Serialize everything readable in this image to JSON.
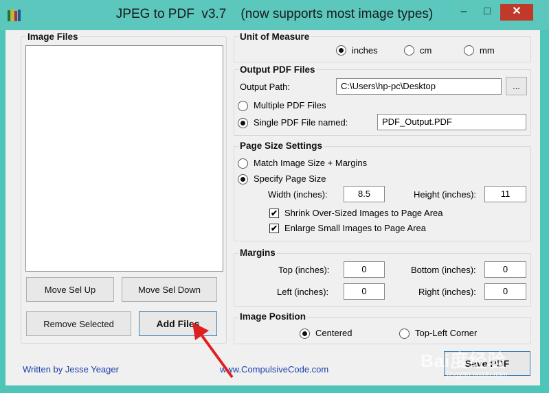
{
  "window": {
    "title": "JPEG to PDF  v3.7    (now supports most image types)",
    "minimize": "–",
    "maximize": "□",
    "close": "✕"
  },
  "image_files": {
    "title": "Image Files",
    "items": [],
    "move_up": "Move Sel Up",
    "move_down": "Move Sel Down",
    "remove": "Remove Selected",
    "add": "Add Files"
  },
  "unit": {
    "title": "Unit of Measure",
    "options": [
      "inches",
      "cm",
      "mm"
    ],
    "selected": "inches"
  },
  "output": {
    "title": "Output PDF Files",
    "path_label": "Output Path:",
    "path_value": "C:\\Users\\hp-pc\\Desktop",
    "browse": "...",
    "multiple_label": "Multiple PDF Files",
    "single_label": "Single PDF File named:",
    "single_value": "PDF_Output.PDF",
    "selected": "single"
  },
  "page_size": {
    "title": "Page Size Settings",
    "match_label": "Match Image Size + Margins",
    "specify_label": "Specify Page Size",
    "selected": "specify",
    "width_label": "Width (inches):",
    "width_value": "8.5",
    "height_label": "Height (inches):",
    "height_value": "11",
    "shrink_label": "Shrink Over-Sized Images to Page Area",
    "shrink_checked": true,
    "enlarge_label": "Enlarge Small Images to Page Area",
    "enlarge_checked": true,
    "check_mark": "✔"
  },
  "margins": {
    "title": "Margins",
    "top_label": "Top (inches):",
    "top_value": "0",
    "bottom_label": "Bottom (inches):",
    "bottom_value": "0",
    "left_label": "Left (inches):",
    "left_value": "0",
    "right_label": "Right (inches):",
    "right_value": "0"
  },
  "image_position": {
    "title": "Image Position",
    "centered_label": "Centered",
    "topleft_label": "Top-Left Corner",
    "selected": "centered"
  },
  "footer": {
    "author": "Written by Jesse Yeager",
    "website": "www.CompulsiveCode.com",
    "save": "Save PDF"
  },
  "overlay": {
    "watermark": "Bai度经验",
    "watermark_sub": "jingyan.baidu.com",
    "arrow_color": "#e02020"
  },
  "colors": {
    "desktop": "#2fb0a6",
    "titlebar": "#5bc7bd",
    "close_button": "#c0392b",
    "link": "#1a3faa"
  }
}
